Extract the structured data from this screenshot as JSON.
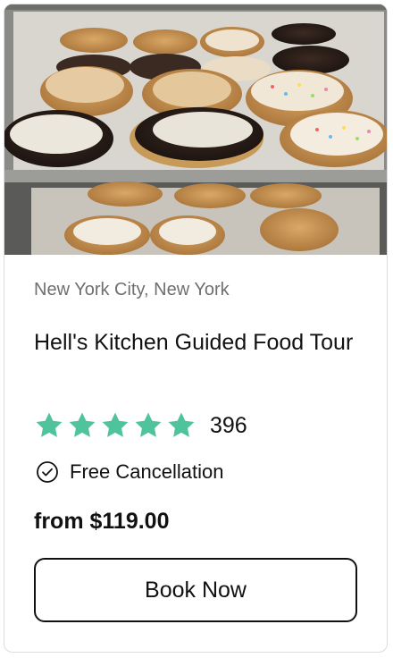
{
  "card": {
    "image_alt": "cookies on baking trays",
    "location": "New York City, New York",
    "title": "Hell's Kitchen Guided Food Tour",
    "rating": {
      "stars": 5,
      "review_count": "396",
      "star_color": "#4fc39b"
    },
    "cancellation": {
      "icon": "check-circle-icon",
      "text": "Free Cancellation"
    },
    "price": "from $119.00",
    "cta": {
      "label": "Book Now"
    }
  }
}
